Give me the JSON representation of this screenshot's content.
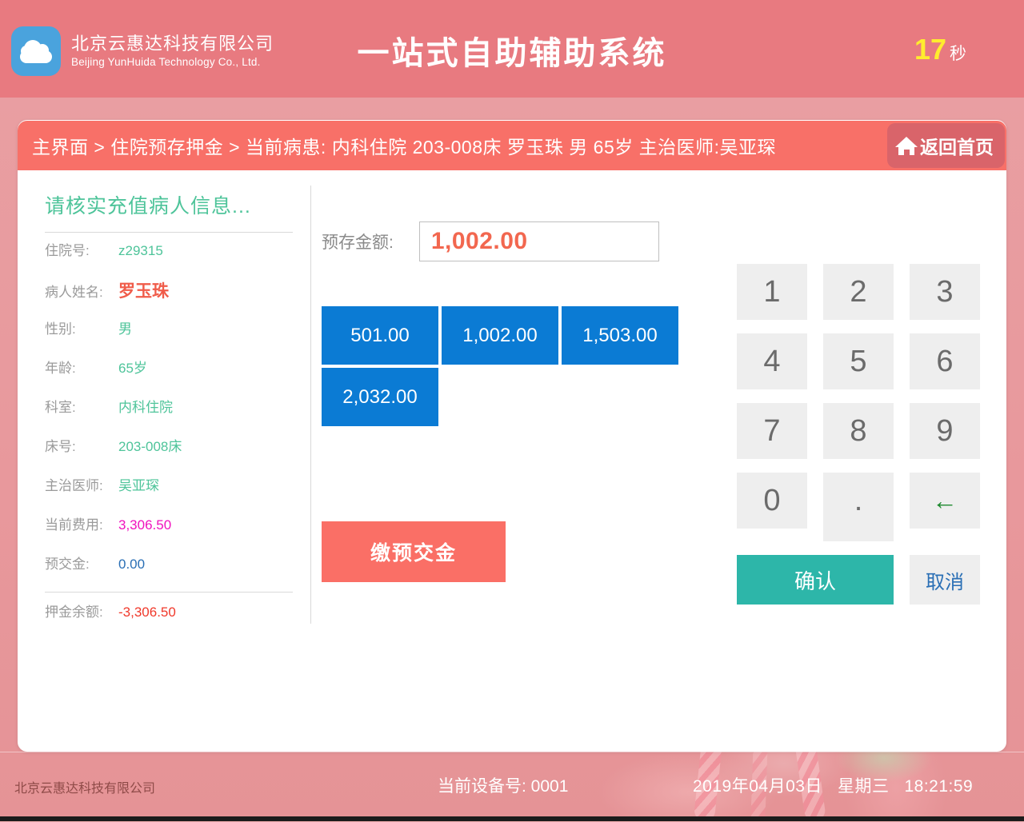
{
  "header": {
    "logo_icon": "cloud-icon",
    "company_cn": "北京云惠达科技有限公司",
    "company_en": "Beijing YunHuida Technology Co., Ltd.",
    "app_title": "一站式自助辅助系统",
    "timer_value": "17",
    "timer_unit": "秒",
    "timer_color": "#ffec2e",
    "bar_color": "#e87a80"
  },
  "breadcrumb": {
    "text": "主界面 > 住院预存押金 > 当前病患: 内科住院  203-008床  罗玉珠  男  65岁  主治医师:吴亚琛",
    "home_button_label": "返回首页",
    "home_icon": "home-icon",
    "bar_color": "#f87068"
  },
  "info_panel": {
    "title": "请核实充值病人信息...",
    "title_color": "#4ec49a",
    "rows": [
      {
        "label": "住院号:",
        "value": "z29315",
        "style": "default"
      },
      {
        "label": "病人姓名:",
        "value": "罗玉珠",
        "style": "name"
      },
      {
        "label": "性别:",
        "value": "男",
        "style": "default"
      },
      {
        "label": "年龄:",
        "value": "65岁",
        "style": "default"
      },
      {
        "label": "科室:",
        "value": "内科住院",
        "style": "default"
      },
      {
        "label": "床号:",
        "value": "203-008床",
        "style": "default"
      },
      {
        "label": "主治医师:",
        "value": "吴亚琛",
        "style": "default"
      },
      {
        "label": "当前费用:",
        "value": "3,306.50",
        "style": "fee"
      },
      {
        "label": "预交金:",
        "value": "0.00",
        "style": "prepaid"
      }
    ],
    "balance": {
      "label": "押金余额:",
      "value": "-3,306.50",
      "color": "#f0392b"
    }
  },
  "amount": {
    "label": "预存金额:",
    "value": "1,002.00",
    "value_color": "#f2674f",
    "presets": [
      "501.00",
      "1,002.00",
      "1,503.00",
      "2,032.00"
    ],
    "preset_color": "#0b7bd4",
    "submit_label": "缴预交金",
    "submit_color": "#fa6f66"
  },
  "keypad": {
    "keys": [
      "1",
      "2",
      "3",
      "4",
      "5",
      "6",
      "7",
      "8",
      "9",
      "0",
      ".",
      "←"
    ],
    "backspace_icon": "backspace-arrow-icon",
    "confirm_label": "确认",
    "confirm_color": "#2db6a9",
    "cancel_label": "取消",
    "cancel_color": "#2a6fb5"
  },
  "footer": {
    "company": "北京云惠达科技有限公司",
    "device": "当前设备号: 0001",
    "date": "2019年04月03日",
    "weekday": "星期三",
    "time": "18:21:59"
  }
}
